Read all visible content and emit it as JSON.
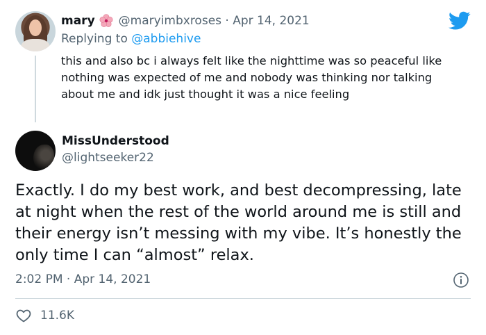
{
  "parent_tweet": {
    "author_name": "mary",
    "handle": "@maryimbxroses",
    "separator": "·",
    "date": "Apr 14, 2021",
    "replying_prefix": "Replying to",
    "replying_to": "@abbiehive",
    "text": "this and also bc i always felt like the nighttime was so peaceful like nothing was expected of me and nobody was thinking nor talking about me and idk just thought it was a nice feeling"
  },
  "main_tweet": {
    "author_name": "MissUnderstood",
    "handle": "@lightseeker22",
    "text": "Exactly. I do my best work, and best decompressing, late at night when the rest of the world around me is still and their energy isn’t messing with my vibe. It’s honestly the only time I can “almost” relax.",
    "timestamp": "2:02 PM · Apr 14, 2021",
    "like_count": "11.6K"
  },
  "icons": {
    "brand": "twitter-bird-icon",
    "flower": "hibiscus-emoji",
    "info": "info-icon",
    "like": "heart-icon"
  },
  "colors": {
    "twitter_blue": "#1d9bf0",
    "secondary_text": "#536471",
    "primary_text": "#0f1419",
    "divider": "#cfd9de"
  }
}
